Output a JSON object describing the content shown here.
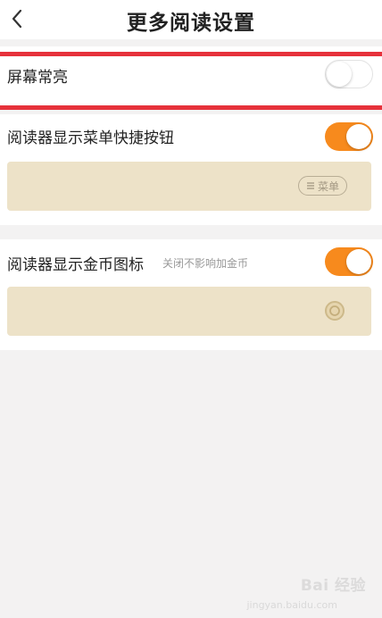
{
  "header": {
    "title": "更多阅读设置",
    "back_icon": "chevron-left-icon"
  },
  "settings": [
    {
      "label": "屏幕常亮",
      "toggle": "off"
    },
    {
      "label": "阅读器显示菜单快捷按钮",
      "toggle": "on",
      "preview": {
        "chip_label": "菜单",
        "chip_icon": "menu-lines-icon"
      }
    },
    {
      "label": "阅读器显示金币图标",
      "hint": "关闭不影响加金币",
      "toggle": "on",
      "preview": {
        "icon": "coin-icon"
      }
    }
  ],
  "colors": {
    "accent": "#f78a1d",
    "highlight_border": "#e6313b",
    "preview_bg": "#ede2c8",
    "page_bg": "#f3f2f2"
  },
  "watermark": {
    "brand": "Bai 经验",
    "url": "jingyan.baidu.com"
  }
}
